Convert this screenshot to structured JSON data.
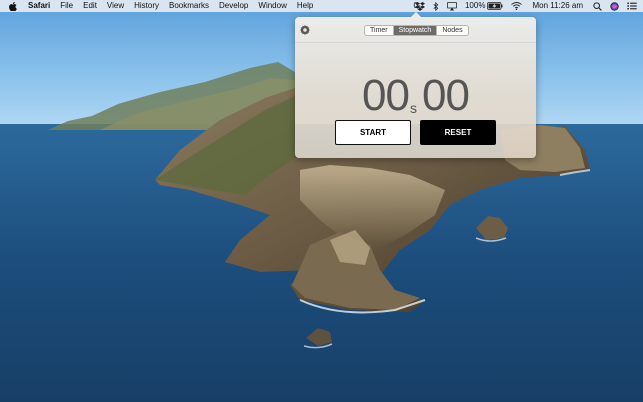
{
  "menubar": {
    "app_name": "Safari",
    "menus": [
      "File",
      "Edit",
      "View",
      "History",
      "Bookmarks",
      "Develop",
      "Window",
      "Help"
    ],
    "app_indicator": "0",
    "app_indicator_unit": "s",
    "battery": "100%",
    "clock": "Mon 11:26 am"
  },
  "stopwatch": {
    "tabs": [
      {
        "label": "Timer",
        "active": false
      },
      {
        "label": "Stopwatch",
        "active": true
      },
      {
        "label": "Nodes",
        "active": false
      }
    ],
    "seconds": "00",
    "seconds_unit": "s",
    "hundredths": "00",
    "start_label": "START",
    "reset_label": "RESET"
  },
  "icons": {
    "apple": "apple-logo-icon",
    "gear": "gear-icon",
    "dropbox": "dropbox-icon",
    "bluetooth": "bluetooth-icon",
    "airplay": "airplay-icon",
    "battery": "battery-charging-icon",
    "wifi": "wifi-icon",
    "search": "spotlight-search-icon",
    "siri": "siri-icon",
    "notifications": "notification-center-icon"
  },
  "colors": {
    "popover_bg": "#ebe4da",
    "tab_active_bg": "#6e6c69",
    "start_bg": "#ffffff",
    "reset_bg": "#000000",
    "readout": "#555554"
  }
}
